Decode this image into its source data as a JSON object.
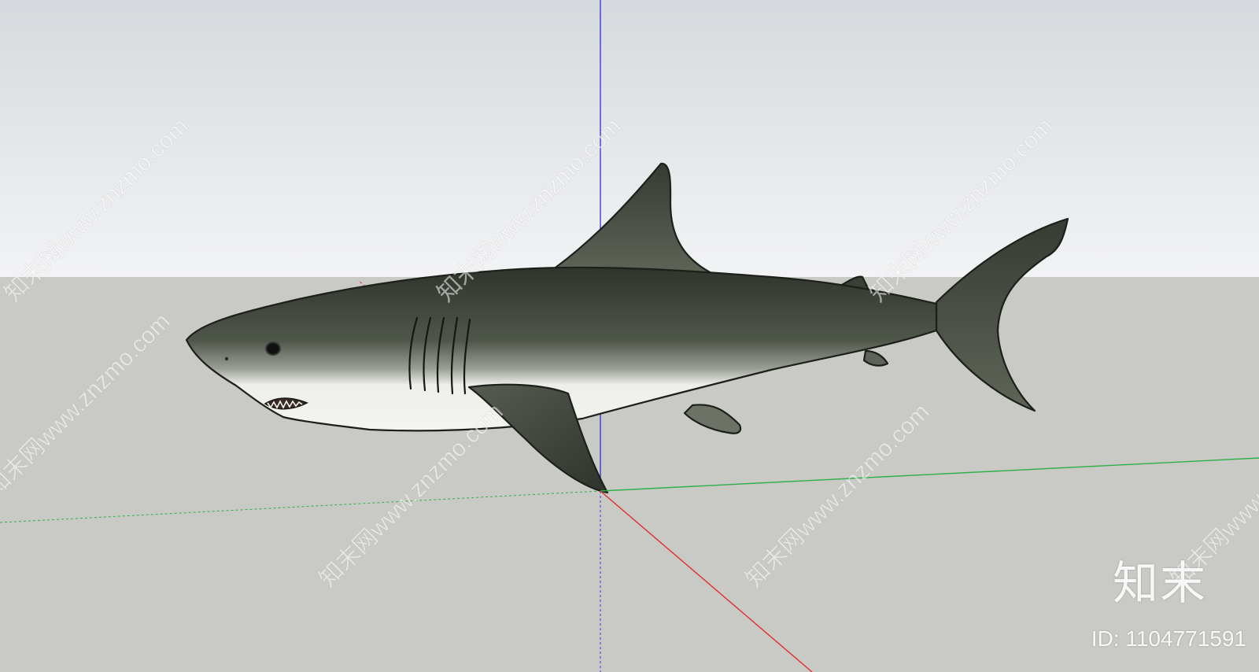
{
  "scene": {
    "colors": {
      "sky_top": "#d6d9dd",
      "sky_bottom": "#f2f3f5",
      "ground": "#c9c9c5",
      "axis_blue": "#3b3bd6",
      "axis_red": "#e03030",
      "axis_green": "#2fb04a",
      "shark_dark": "#3c4138",
      "shark_belly": "#f1f1ec"
    },
    "objects": {
      "model_icon": "shark-model",
      "axes_icon": "axes-icon"
    }
  },
  "watermarks": {
    "repeated_text": "知末网www.znzmo.com",
    "logo_text": "知末",
    "id_text": "ID: 1104771591"
  }
}
